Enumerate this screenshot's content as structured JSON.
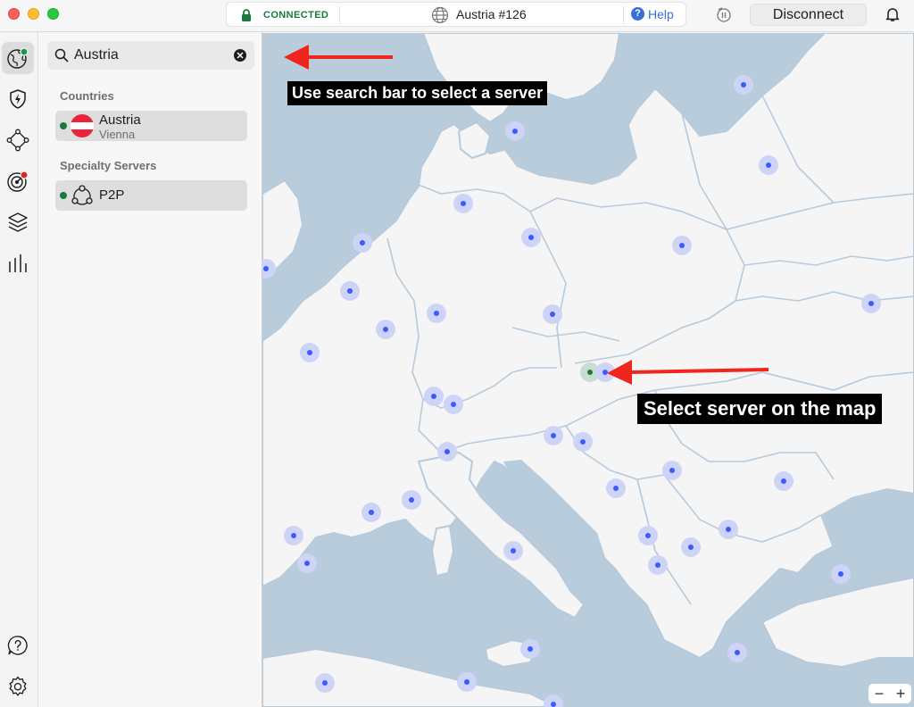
{
  "status": {
    "connection": "CONNECTED",
    "server": "Austria #126",
    "help": "Help",
    "disconnect": "Disconnect"
  },
  "rail": {
    "icons": [
      "globe-icon",
      "lightning-shield-icon",
      "meshnet-icon",
      "target-icon",
      "layers-icon",
      "stats-icon",
      "help-circle-icon",
      "settings-icon"
    ]
  },
  "search": {
    "value": "Austria",
    "placeholder": "Search"
  },
  "sidebar": {
    "countries_header": "Countries",
    "country": {
      "name": "Austria",
      "city": "Vienna"
    },
    "specialty_header": "Specialty Servers",
    "specialty": {
      "name": "P2P"
    }
  },
  "annotations": {
    "search_hint": "Use search bar to select a server",
    "map_hint": "Select server on the map"
  },
  "map": {
    "zoom_out": "−",
    "zoom_in": "+"
  },
  "colors": {
    "connected_green": "#1a7a3e",
    "accent_blue": "#3a6fd8",
    "server_dot": "#3b5bff",
    "arrow_red": "#f0251b",
    "land": "#f5f5f6",
    "sea": "#b9ccdc"
  }
}
